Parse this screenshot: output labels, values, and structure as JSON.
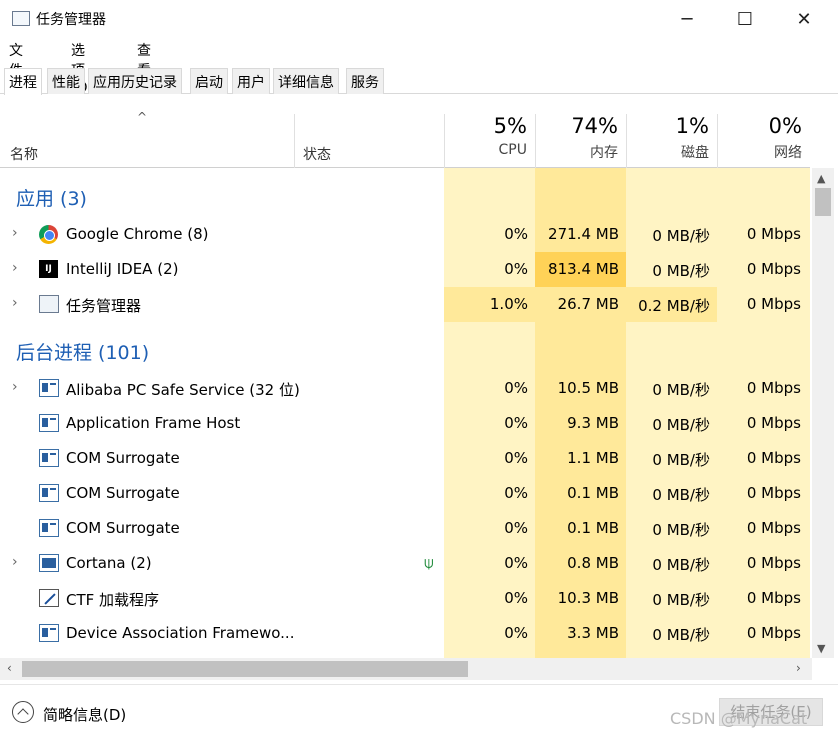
{
  "window": {
    "title": "任务管理器",
    "minimize_glyph": "─",
    "maximize_glyph": "☐",
    "close_glyph": "✕"
  },
  "menu": [
    "文件(F)",
    "选项(O)",
    "查看(V)"
  ],
  "tabs": [
    "进程",
    "性能",
    "应用历史记录",
    "启动",
    "用户",
    "详细信息",
    "服务"
  ],
  "active_tab": "进程",
  "header": {
    "sort_indicator": "^",
    "name": "名称",
    "status": "状态",
    "cpu": {
      "pct": "5%",
      "label": "CPU"
    },
    "memory": {
      "pct": "74%",
      "label": "内存"
    },
    "disk": {
      "pct": "1%",
      "label": "磁盘"
    },
    "network": {
      "pct": "0%",
      "label": "网络"
    }
  },
  "groups": {
    "apps": "应用 (3)",
    "background": "后台进程 (101)"
  },
  "apps": [
    {
      "name": "Google Chrome (8)",
      "icon": "chrome-icon",
      "cpu": "0%",
      "memory": "271.4 MB",
      "disk": "0 MB/秒",
      "network": "0 Mbps"
    },
    {
      "name": "IntelliJ IDEA (2)",
      "icon": "intellij-icon",
      "icon_text": "IJ",
      "cpu": "0%",
      "memory": "813.4 MB",
      "disk": "0 MB/秒",
      "network": "0 Mbps"
    },
    {
      "name": "任务管理器",
      "icon": "task-manager-icon",
      "cpu": "1.0%",
      "memory": "26.7 MB",
      "disk": "0.2 MB/秒",
      "network": "0 Mbps"
    }
  ],
  "background": [
    {
      "name": "Alibaba PC Safe Service (32 位)",
      "icon": "service-window-icon",
      "cpu": "0%",
      "memory": "10.5 MB",
      "disk": "0 MB/秒",
      "network": "0 Mbps"
    },
    {
      "name": "Application Frame Host",
      "icon": "service-window-icon",
      "cpu": "0%",
      "memory": "9.3 MB",
      "disk": "0 MB/秒",
      "network": "0 Mbps"
    },
    {
      "name": "COM Surrogate",
      "icon": "service-window-icon",
      "cpu": "0%",
      "memory": "1.1 MB",
      "disk": "0 MB/秒",
      "network": "0 Mbps"
    },
    {
      "name": "COM Surrogate",
      "icon": "service-window-icon",
      "cpu": "0%",
      "memory": "0.1 MB",
      "disk": "0 MB/秒",
      "network": "0 Mbps"
    },
    {
      "name": "COM Surrogate",
      "icon": "service-window-icon",
      "cpu": "0%",
      "memory": "0.1 MB",
      "disk": "0 MB/秒",
      "network": "0 Mbps"
    },
    {
      "name": "Cortana (2)",
      "icon": "cortana-icon",
      "status_icon": "leaf-icon",
      "status_glyph": "⍦",
      "cpu": "0%",
      "memory": "0.8 MB",
      "disk": "0 MB/秒",
      "network": "0 Mbps"
    },
    {
      "name": "CTF 加载程序",
      "icon": "ctf-loader-icon",
      "cpu": "0%",
      "memory": "10.3 MB",
      "disk": "0 MB/秒",
      "network": "0 Mbps"
    },
    {
      "name": "Device Association Framewo...",
      "icon": "service-window-icon",
      "cpu": "0%",
      "memory": "3.3 MB",
      "disk": "0 MB/秒",
      "network": "0 Mbps"
    }
  ],
  "expander_glyph": "›",
  "scroll": {
    "up": "▲",
    "down": "▼",
    "left": "‹",
    "right": "›"
  },
  "footer": {
    "brief": "简略信息(D)",
    "end_task": "结束任务(E)",
    "watermark": "CSDN @MynaCat"
  },
  "colors": {
    "heat_light": "#fff4c4",
    "heat_medium": "#ffe99a",
    "heat_high": "#ffd257",
    "group_title": "#1e5fb4"
  }
}
